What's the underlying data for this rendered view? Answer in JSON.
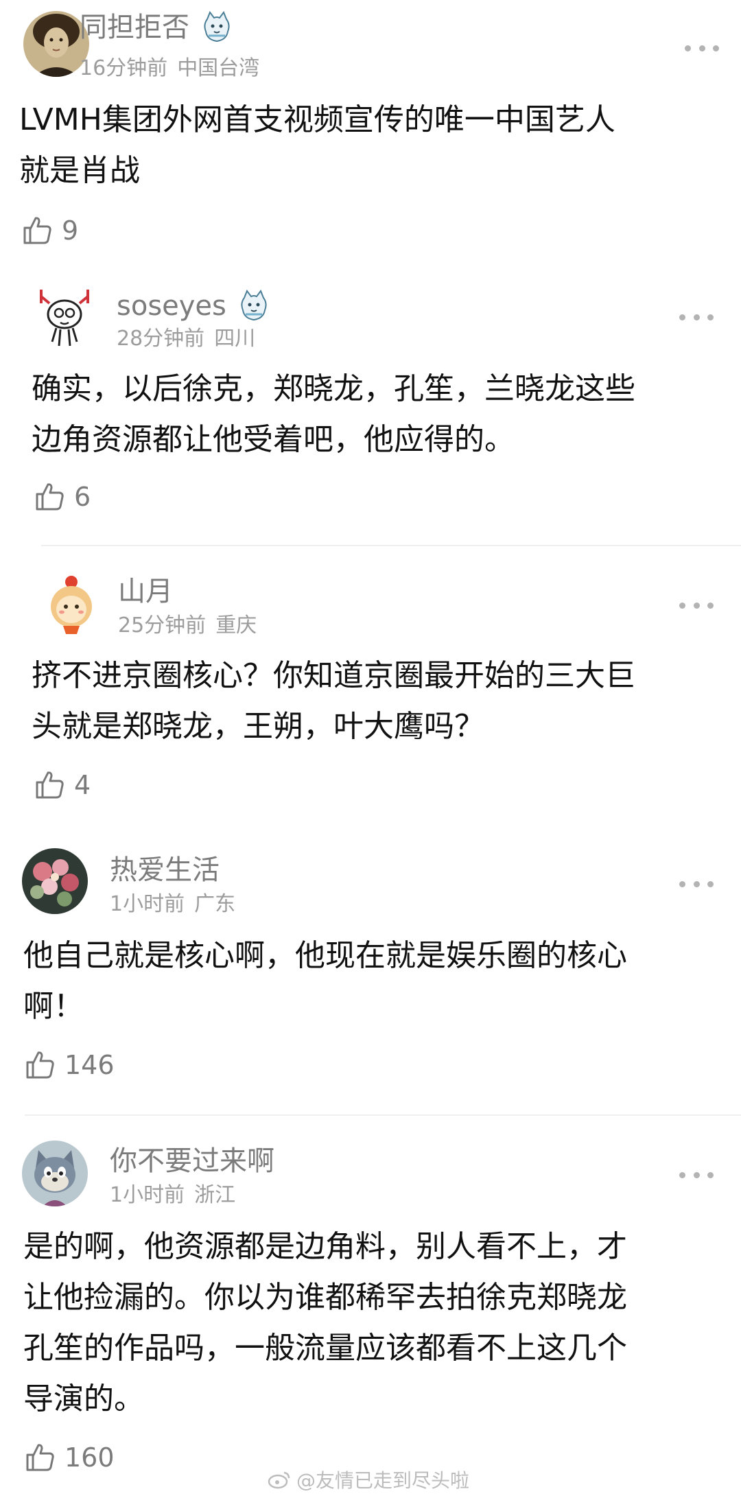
{
  "comments": [
    {
      "username": "同担拒否",
      "time": "16分钟前",
      "location": "中国台湾",
      "text_lines": [
        "LVMH集团外网首支视频宣传的唯一中国艺人",
        "就是肖战"
      ],
      "likes": "9",
      "avatar": "vintage-portrait",
      "badge": "cat-badge-icon"
    },
    {
      "username": "soseyes",
      "time": "28分钟前",
      "location": "四川",
      "text_lines": [
        "确实，以后徐克，郑晓龙，孔笙，兰晓龙这些",
        "边角资源都让他受着吧，他应得的。"
      ],
      "likes": "6",
      "avatar": "cartoon-face",
      "badge": "cat-badge-icon"
    },
    {
      "username": "山月",
      "time": "25分钟前",
      "location": "重庆",
      "text_lines": [
        "挤不进京圈核心？你知道京圈最开始的三大巨",
        "头就是郑晓龙，王朔，叶大鹰吗？"
      ],
      "likes": "4",
      "avatar": "cartoon-girl"
    },
    {
      "username": "热爱生活",
      "time": "1小时前",
      "location": "广东",
      "text_lines": [
        "他自己就是核心啊，他现在就是娱乐圈的核心",
        "啊！"
      ],
      "likes": "146",
      "avatar": "flower-bouquet"
    },
    {
      "username": "你不要过来啊",
      "time": "1小时前",
      "location": "浙江",
      "text_lines": [
        "是的啊，他资源都是边角料，别人看不上，才",
        "让他捡漏的。你以为谁都稀罕去拍徐克郑晓龙",
        "孔笙的作品吗，一般流量应该都看不上这几个",
        "导演的。"
      ],
      "likes": "160",
      "avatar": "tom-cat"
    }
  ],
  "watermark": "@友情已走到尽头啦",
  "colors": {
    "text": "#111111",
    "username": "#7b7b7b",
    "meta": "#9c9c9c",
    "divider": "#efefef"
  }
}
